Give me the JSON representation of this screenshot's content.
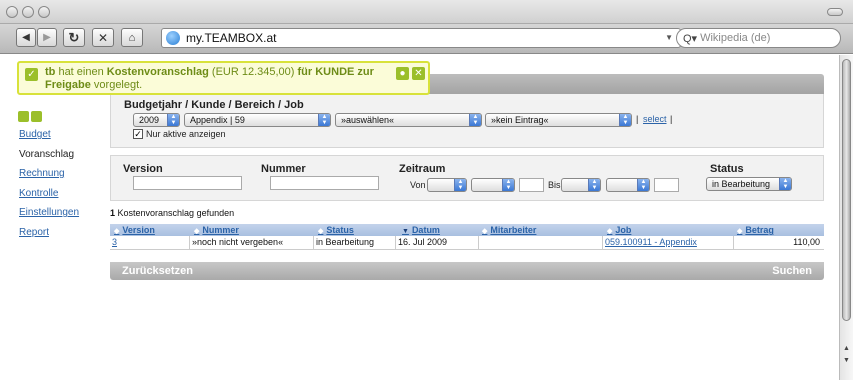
{
  "browser": {
    "url": "my.TEAMBOX.at",
    "search_placeholder": "Wikipedia (de)"
  },
  "notification": {
    "user": "tb",
    "text1": " hat einen ",
    "doc_type": "Kostenvoranschlag",
    "amount": " (EUR 12.345,00) ",
    "for_label": "für KUNDE zur",
    "release_label": "Freigabe",
    "text2": " vorgelegt."
  },
  "sidebar": {
    "items": [
      {
        "label": "Budget"
      },
      {
        "label": "Voranschlag"
      },
      {
        "label": "Rechnung"
      },
      {
        "label": "Kontrolle"
      },
      {
        "label": "Einstellungen"
      },
      {
        "label": "Report"
      }
    ]
  },
  "filter": {
    "heading": "Budgetjahr / Kunde / Bereich / Job",
    "year": "2009",
    "customer": "Appendix | 59",
    "area": "»auswählen«",
    "job": "»kein Eintrag«",
    "separator": "|",
    "select_link": "select",
    "only_active_label": "Nur aktive anzeigen"
  },
  "search": {
    "version_label": "Version",
    "number_label": "Nummer",
    "period_label": "Zeitraum",
    "from_label": "Von",
    "to_label": "Bis",
    "status_label": "Status",
    "status_value": "in Bearbeitung"
  },
  "results": {
    "count": "1",
    "count_text": " Kostenvoranschlag gefunden"
  },
  "table": {
    "headers": [
      "Version",
      "Nummer",
      "Status",
      "Datum",
      "Mitarbeiter",
      "Job",
      "Betrag"
    ],
    "rows": [
      {
        "version": "3",
        "number": "»noch nicht vergeben«",
        "status": "in Bearbeitung",
        "date": "16. Jul 2009",
        "employee": "",
        "job": "059.100911 - Appendix",
        "amount": "110,00"
      }
    ]
  },
  "actions": {
    "reset_label": "Zurücksetzen",
    "search_label": "Suchen"
  }
}
